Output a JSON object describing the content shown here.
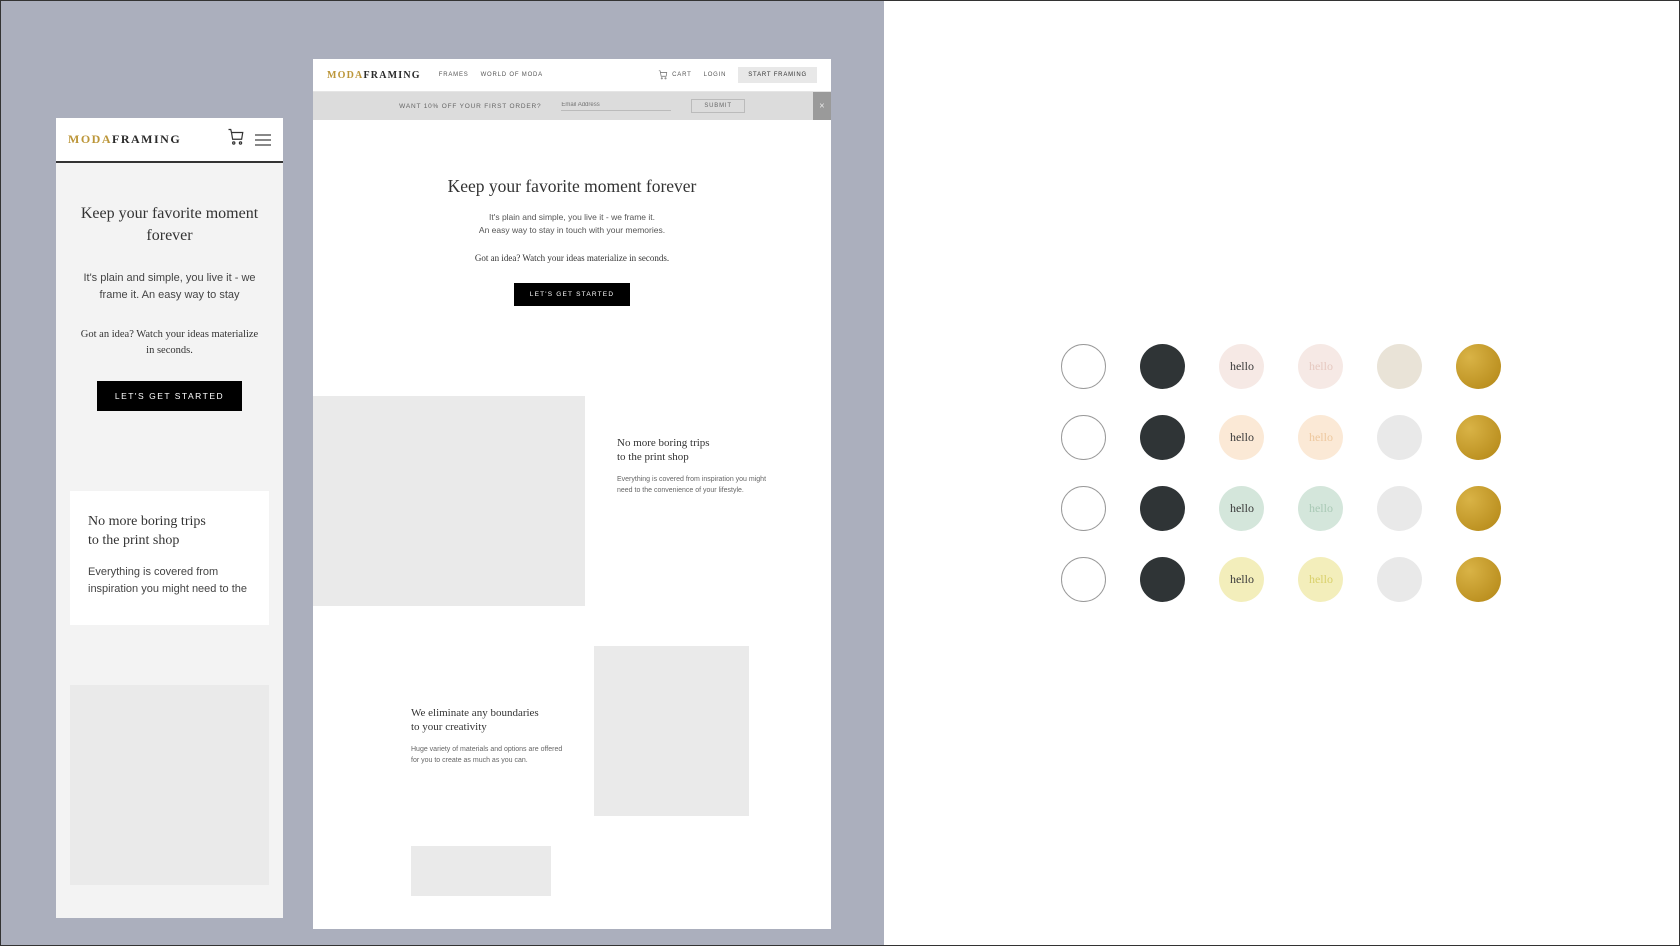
{
  "brand": {
    "part1": "MODA",
    "part2": "FRAMING"
  },
  "mobile": {
    "hero_title": "Keep your favorite moment forever",
    "hero_sub": "It's plain and simple, you live it - we frame it. An easy way to stay",
    "hero_idea": "Got an idea? Watch your ideas materialize in seconds.",
    "cta": "LET'S GET STARTED",
    "section1_title": "No more boring trips\nto the print shop",
    "section1_body": "Everything is covered from inspiration you might need to the"
  },
  "desktop": {
    "nav": {
      "frames": "FRAMES",
      "world": "WORLD OF MODA"
    },
    "cart": "CART",
    "login": "LOGIN",
    "start": "START FRAMING",
    "promo": "WANT 10% OFF YOUR FIRST ORDER?",
    "email_placeholder": "Email Address",
    "submit": "SUBMIT",
    "close": "×",
    "hero_title": "Keep your favorite moment forever",
    "hero_sub": "It's plain and simple, you live it - we frame it.\nAn easy way to stay in touch with your memories.",
    "hero_idea": "Got an idea? Watch your ideas materialize in seconds.",
    "cta": "LET'S GET STARTED",
    "block1_title": "No more boring trips\nto the print shop",
    "block1_body": "Everything is covered from inspiration you might need to the convenience of your lifestyle.",
    "block2_title": "We eliminate any boundaries\nto your creativity",
    "block2_body": "Huge variety of materials and options are offered for you to create as much as you can."
  },
  "palette": {
    "label": "hello",
    "rows": [
      {
        "c3_bg": "#f6e9e5",
        "c3_fg": "#3a3a3a",
        "c4_bg": "#f6e9e5",
        "c4_fg": "#e6c9c0",
        "c5_bg": "#e9e3d7"
      },
      {
        "c3_bg": "#fbe9d6",
        "c3_fg": "#3a3a3a",
        "c4_bg": "#fbe9d6",
        "c4_fg": "#eec89e",
        "c5_bg": "#e9e9e9"
      },
      {
        "c3_bg": "#d4e6db",
        "c3_fg": "#3a3a3a",
        "c4_bg": "#d4e6db",
        "c4_fg": "#a9c9b5",
        "c5_bg": "#e9e9e9"
      },
      {
        "c3_bg": "#f3eebb",
        "c3_fg": "#3a3a3a",
        "c4_bg": "#f3eebb",
        "c4_fg": "#d9d06a",
        "c5_bg": "#e9e9e9"
      }
    ]
  }
}
